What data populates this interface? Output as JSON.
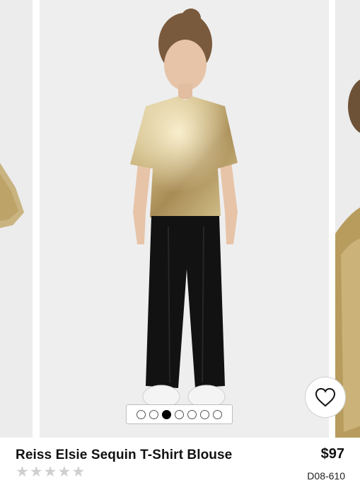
{
  "product": {
    "title": "Reiss Elsie Sequin T-Shirt Blouse",
    "price": "$97",
    "sku": "D08-610",
    "rating": 0,
    "rating_max": 5,
    "star_glyph": "★"
  },
  "carousel": {
    "total_images": 7,
    "current_index": 2,
    "wishlist_icon": "heart-icon"
  },
  "colors": {
    "sequin_gold": "#c8b27a",
    "velvet_black": "#121212",
    "background": "#eeeeee",
    "star_empty": "#cfcfcf"
  }
}
